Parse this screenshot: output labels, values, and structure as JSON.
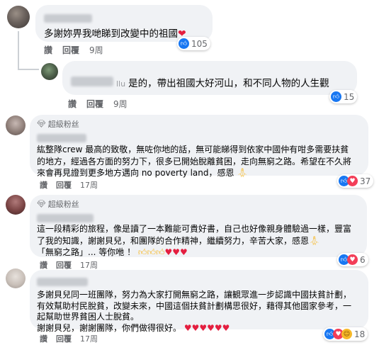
{
  "comments": [
    {
      "text_lines": [
        "多謝妳畀我哋睇到改變中的祖國"
      ],
      "trailing_emoji": "❤",
      "like_label": "讚",
      "reply_label": "回覆",
      "time": "9周",
      "reaction_count": "105",
      "reaction_icons": [
        "like-icon"
      ]
    },
    {
      "name_visible_fragment": "llu",
      "text_lines": [
        "是的，帶出祖國大好河山，和不同人物的人生觀"
      ],
      "like_label": "讚",
      "reply_label": "回覆",
      "time": "9周",
      "reaction_count": "15",
      "reaction_icons": [
        "like-icon"
      ]
    },
    {
      "badge": "超級粉丝",
      "text_lines": [
        "紘整隊crew 最高的致敬，無咗你地的話，無可能睇得到依家中國仲有咁多需要扶貧",
        "的地方，經過各方面的努力下，很多已開始脫離貧困，走向無窮之路。希望在不久將",
        "來會再見證到更多地方邁向 no poverty land，感恩"
      ],
      "like_label": "讚",
      "reply_label": "回覆",
      "time": "17周",
      "reaction_count": "37",
      "reaction_icons": [
        "like-icon",
        "love-icon"
      ]
    },
    {
      "badge": "超級粉丝",
      "text_lines": [
        "這一段精彩的旅程，像是讀了一本難能可貴好書，自己也好像親身體驗過一樣，豐富",
        "了我的知識，謝謝貝兒，和團隊的合作精神，繼續努力，辛苦大家，感恩",
        "「無窮之路」... 等你咃 ！"
      ],
      "like_label": "讚",
      "reply_label": "回覆",
      "time": "17周",
      "reaction_count": "6",
      "reaction_icons": [
        "like-icon",
        "love-icon"
      ]
    },
    {
      "text_lines": [
        "多謝貝兒同一班團隊，努力為大家打開無窮之路，讓観眾進一步認識中國扶貧計劃，",
        "有效幫助村民脫貧，改變未來，中國這個扶貧計劃構思很好，藉得其他國家參考，一",
        "起幫助世界貧困人士脫貧。",
        "謝謝貝兒，謝謝團隊，你們做得很好。"
      ],
      "like_label": "讚",
      "reply_label": "回覆",
      "time": "17周",
      "reaction_count": "18",
      "reaction_icons": [
        "like-icon",
        "love-icon",
        "care-icon"
      ]
    }
  ],
  "colors": {
    "bubble": "#f0f2f5",
    "meta_text": "#65676b",
    "like_blue": "#1877f2",
    "love_red": "#f33e58"
  }
}
